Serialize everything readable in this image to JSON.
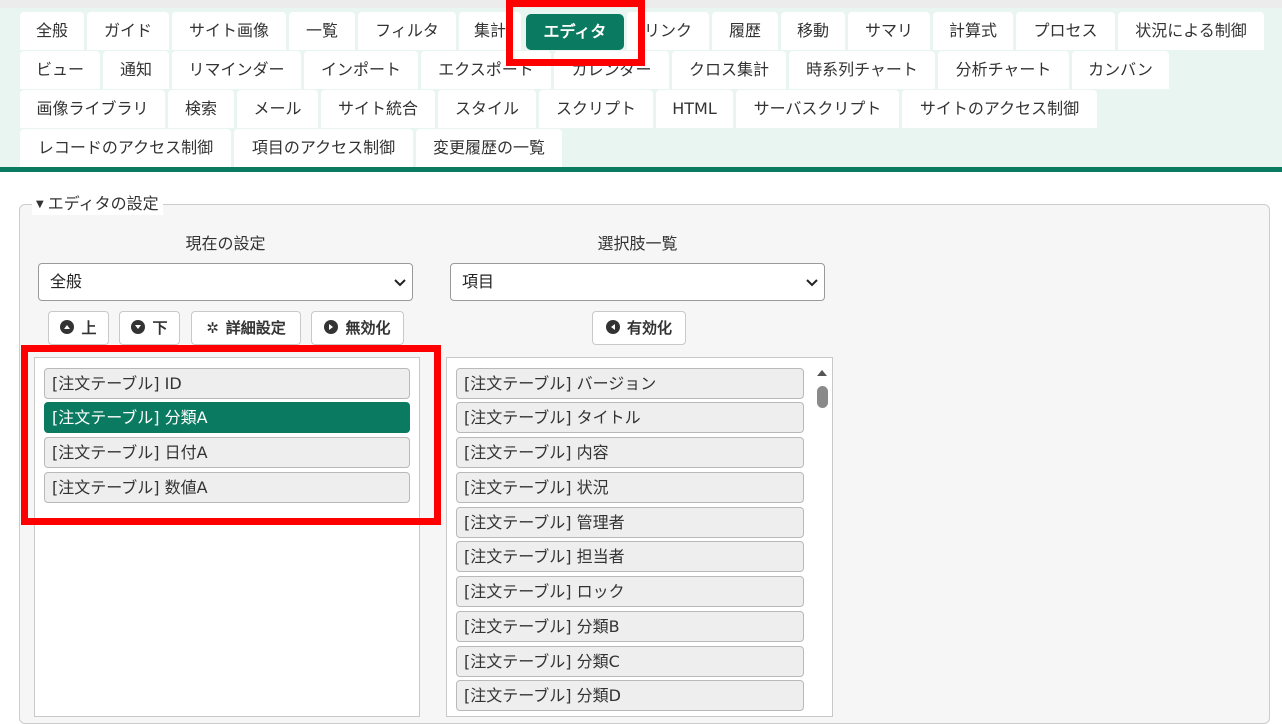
{
  "tabs": [
    {
      "label": "全般"
    },
    {
      "label": "ガイド"
    },
    {
      "label": "サイト画像"
    },
    {
      "label": "一覧"
    },
    {
      "label": "フィルタ"
    },
    {
      "label": "集計"
    },
    {
      "label": "エディタ"
    },
    {
      "label": "リンク"
    },
    {
      "label": "履歴"
    },
    {
      "label": "移動"
    },
    {
      "label": "サマリ"
    },
    {
      "label": "計算式"
    },
    {
      "label": "プロセス"
    },
    {
      "label": "状況による制御"
    },
    {
      "label": "ビュー"
    },
    {
      "label": "通知"
    },
    {
      "label": "リマインダー"
    },
    {
      "label": "インポート"
    },
    {
      "label": "エクスポート"
    },
    {
      "label": "カレンダー"
    },
    {
      "label": "クロス集計"
    },
    {
      "label": "時系列チャート"
    },
    {
      "label": "分析チャート"
    },
    {
      "label": "カンバン"
    },
    {
      "label": "画像ライブラリ"
    },
    {
      "label": "検索"
    },
    {
      "label": "メール"
    },
    {
      "label": "サイト統合"
    },
    {
      "label": "スタイル"
    },
    {
      "label": "スクリプト"
    },
    {
      "label": "HTML"
    },
    {
      "label": "サーバスクリプト"
    },
    {
      "label": "サイトのアクセス制御"
    },
    {
      "label": "レコードのアクセス制御"
    },
    {
      "label": "項目のアクセス制御"
    },
    {
      "label": "変更履歴の一覧"
    }
  ],
  "active_tab": "エディタ",
  "section": {
    "title": "エディタの設定"
  },
  "current": {
    "heading": "現在の設定",
    "select_value": "全般",
    "buttons": {
      "up": "上",
      "down": "下",
      "detail": "詳細設定",
      "disable": "無効化"
    },
    "items": [
      {
        "label": "[注文テーブル] ID"
      },
      {
        "label": "[注文テーブル] 分類A"
      },
      {
        "label": "[注文テーブル] 日付A"
      },
      {
        "label": "[注文テーブル] 数値A"
      }
    ],
    "selected_item": "[注文テーブル] 分類A"
  },
  "choices": {
    "heading": "選択肢一覧",
    "select_value": "項目",
    "buttons": {
      "enable": "有効化"
    },
    "items": [
      {
        "label": "[注文テーブル] バージョン"
      },
      {
        "label": "[注文テーブル] タイトル"
      },
      {
        "label": "[注文テーブル] 内容"
      },
      {
        "label": "[注文テーブル] 状況"
      },
      {
        "label": "[注文テーブル] 管理者"
      },
      {
        "label": "[注文テーブル] 担当者"
      },
      {
        "label": "[注文テーブル] ロック"
      },
      {
        "label": "[注文テーブル] 分類B"
      },
      {
        "label": "[注文テーブル] 分類C"
      },
      {
        "label": "[注文テーブル] 分類D"
      }
    ]
  },
  "colors": {
    "accent": "#0a7a60",
    "highlight": "#ff0000",
    "tab_bar": "#e9f5f0"
  }
}
